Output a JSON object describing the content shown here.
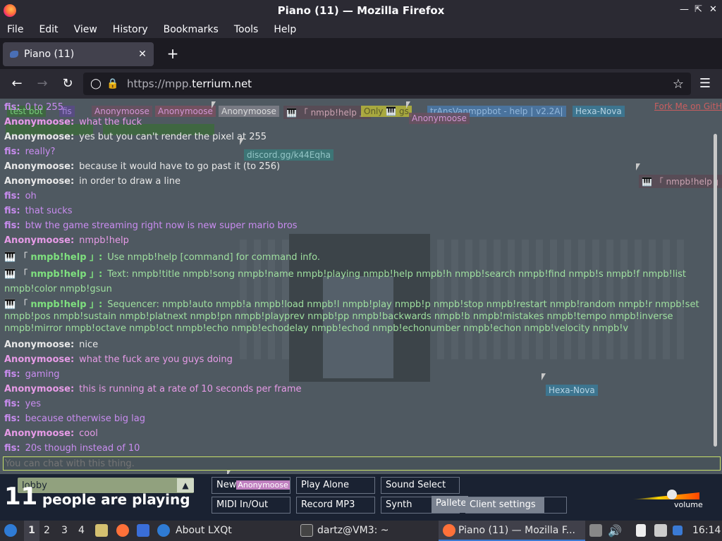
{
  "window": {
    "title": "Piano (11) — Mozilla Firefox"
  },
  "menu": [
    "File",
    "Edit",
    "View",
    "History",
    "Bookmarks",
    "Tools",
    "Help"
  ],
  "tab": {
    "label": "Piano (11)"
  },
  "urlbar": {
    "host_prefix": "https://mpp.",
    "host_domain": "terrium.net"
  },
  "top_tags": [
    "fis",
    "test bot",
    "fis",
    "Anonymoose",
    "Anonymoose",
    "Anonymoose",
    "🎹 「 nmpb!help 」",
    "Only 🎹 gs",
    "trAnsVanmppbot - help | v2.2A|",
    "Hexa-Nova",
    "Fork Me on GitH"
  ],
  "chat": [
    {
      "kind": "fis",
      "name": "fis:",
      "text": "0 to 255"
    },
    {
      "kind": "anonp",
      "name": "Anonymoose:",
      "text": "what the fuck"
    },
    {
      "kind": "anonw",
      "name": "Anonymoose:",
      "text": "yes but you can't render the pixel at 255"
    },
    {
      "kind": "fis",
      "name": "fis:",
      "text": "really?"
    },
    {
      "kind": "anonw",
      "name": "Anonymoose:",
      "text": "because it would have to go past it (to 256)"
    },
    {
      "kind": "anonw",
      "name": "Anonymoose:",
      "text": "in order to draw a line"
    },
    {
      "kind": "fis",
      "name": "fis:",
      "text": "oh"
    },
    {
      "kind": "fis",
      "name": "fis:",
      "text": "that sucks"
    },
    {
      "kind": "fis",
      "name": "fis:",
      "text": "btw the game streaming right now is new super mario bros"
    },
    {
      "kind": "anonp",
      "name": "Anonymoose:",
      "text": "nmpb!help"
    },
    {
      "kind": "bot",
      "prefix": "🎹 「",
      "name": "nmpb!help 」:",
      "text": "Use nmpb!help [command] for command info."
    },
    {
      "kind": "bot",
      "prefix": "🎹 「",
      "name": "nmpb!help 」:",
      "text": "Text: nmpb!title nmpb!song nmpb!name nmpb!playing nmpb!help nmpb!h nmpb!search nmpb!find nmpb!s nmpb!f nmpb!list nmpb!color nmpb!gsun"
    },
    {
      "kind": "bot",
      "prefix": "🎹 「",
      "name": "nmpb!help 」:",
      "text": "Sequencer: nmpb!auto nmpb!a nmpb!load nmpb!l nmpb!play nmpb!p nmpb!stop nmpb!restart nmpb!random nmpb!r nmpb!set nmpb!pos nmpb!sustain nmpb!platnext nmpb!pn nmpb!playprev nmpb!pp nmpb!backwards nmpb!b nmpb!mistakes nmpb!tempo nmpb!inverse nmpb!mirror nmpb!octave nmpb!oct nmpb!echo nmpb!echodelay nmpb!echod nmpb!echonumber nmpb!echon nmpb!velocity nmpb!v"
    },
    {
      "kind": "anonw",
      "name": "Anonymoose:",
      "text": "nice"
    },
    {
      "kind": "anonp",
      "name": "Anonymoose:",
      "text": "what the fuck are you guys doing"
    },
    {
      "kind": "fis",
      "name": "fis:",
      "text": "gaming"
    },
    {
      "kind": "anonp",
      "name": "Anonymoose:",
      "text": "this is running at a rate of 10 seconds per frame"
    },
    {
      "kind": "fis",
      "name": "fis:",
      "text": "yes"
    },
    {
      "kind": "fis",
      "name": "fis:",
      "text": "because otherwise big lag"
    },
    {
      "kind": "anonp",
      "name": "Anonymoose:",
      "text": "cool"
    },
    {
      "kind": "fis",
      "name": "fis:",
      "text": "20s though instead of 10"
    }
  ],
  "floating": {
    "discord": "discord.gg/k44Eqha",
    "nmpb_tag": "🎹 「 nmpb!help 」",
    "anon_tag": "Anonymoose",
    "hexa_tag": "Hexa-Nova"
  },
  "chat_input": {
    "placeholder": "You can chat with this thing."
  },
  "controls": {
    "room": "lobby",
    "player_count": "11",
    "player_label": "people are playing",
    "new_room": "New",
    "new_room_overlay": "Anonymoose",
    "play_alone": "Play Alone",
    "sound_select": "Sound Select",
    "midi": "MIDI In/Out",
    "record": "Record MP3",
    "synth": "Synth",
    "pallete": "Pallete",
    "client_settings": "Client settings",
    "volume_label": "volume"
  },
  "taskbar": {
    "workspaces": [
      "1",
      "2",
      "3",
      "4"
    ],
    "about": "About LXQt",
    "terminal": "dartz@VM3: ~",
    "firefox": "Piano (11) — Mozilla F...",
    "clock": "16:14"
  }
}
